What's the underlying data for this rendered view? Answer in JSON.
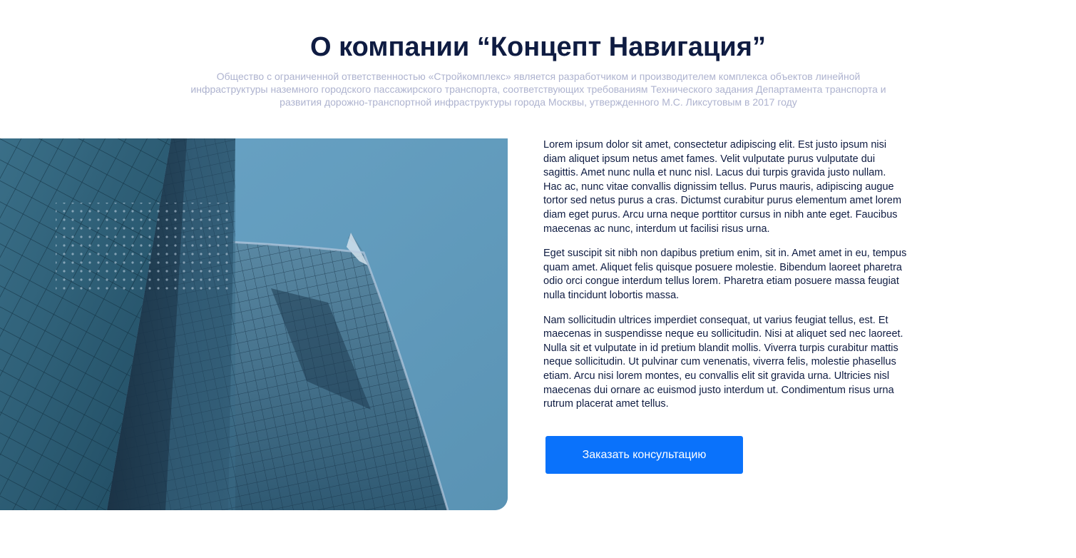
{
  "header": {
    "title": "О компании “Концепт Навигация”",
    "subtitle": "Общество с ограниченной ответственностью «Стройкомплекс» является разработчиком и производителем комплекса объектов линейной инфраструктуры наземного городского пассажирского транспорта, соответствующих требованиям Технического задания Департамента транспорта и развития дорожно-транспортной инфраструктуры города Москвы, утвержденного М.С. Ликсутовым в 2017 году"
  },
  "about": {
    "paragraphs": [
      "Lorem ipsum dolor sit amet, consectetur adipiscing elit. Est justo ipsum nisi diam aliquet ipsum netus amet fames. Velit vulputate purus vulputate dui sagittis. Amet nunc nulla et nunc nisl. Lacus dui turpis gravida justo nullam. Hac ac, nunc vitae convallis dignissim tellus. Purus mauris, adipiscing augue tortor sed netus purus a cras. Dictumst curabitur purus elementum amet lorem diam eget purus. Arcu urna neque porttitor cursus in nibh ante eget. Faucibus maecenas ac nunc, interdum ut facilisi risus urna.",
      "Eget suscipit sit nibh non dapibus pretium enim, sit in. Amet amet in eu, tempus quam amet. Aliquet felis quisque posuere molestie. Bibendum laoreet pharetra odio orci congue interdum tellus lorem. Pharetra etiam posuere massa feugiat nulla tincidunt lobortis massa.",
      "Nam sollicitudin ultrices imperdiet consequat, ut varius feugiat tellus, est. Et maecenas in suspendisse neque eu sollicitudin. Nisi at aliquet sed nec laoreet. Nulla sit et vulputate in id pretium blandit mollis. Viverra turpis curabitur mattis neque sollicitudin. Ut pulvinar cum venenatis, viverra felis, molestie phasellus etiam. Arcu nisi lorem montes, eu convallis elit sit gravida urna. Ultricies nisl maecenas dui ornare ac euismod justo interdum ut. Condimentum risus urna rutrum placerat amet tellus."
    ],
    "cta_label": "Заказать консультацию"
  },
  "colors": {
    "title": "#0f1c42",
    "subtitle": "#aeb3cf",
    "body_text": "#0f1c42",
    "button": "#0a72fb",
    "sky": "#5f9cbd"
  },
  "image": {
    "subject": "skyscrapers-photo"
  }
}
